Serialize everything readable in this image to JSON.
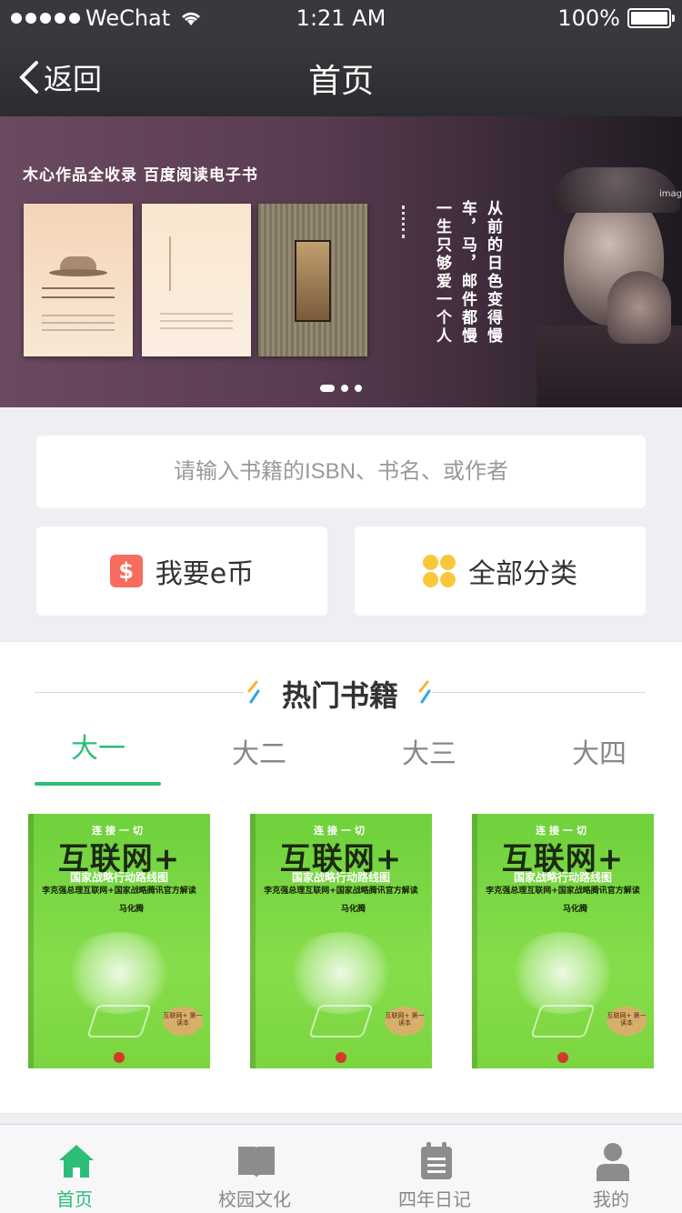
{
  "status_bar": {
    "carrier": "WeChat",
    "time": "1:21 AM",
    "battery": "100%"
  },
  "nav": {
    "back_label": "返回",
    "title": "首页"
  },
  "banner": {
    "headline": "木心作品全收录  百度阅读电子书",
    "poem_columns": [
      "从前的日色变得慢",
      "车，马，邮件都慢",
      "一生只够爱一个人"
    ],
    "side_text": "imag",
    "active_page": 1,
    "page_count": 3
  },
  "search": {
    "placeholder": "请输入书籍的ISBN、书名、或作者"
  },
  "quick_actions": {
    "ecoin_label": "我要e币",
    "ecoin_glyph": "$",
    "categories_label": "全部分类"
  },
  "hot_books": {
    "title": "热门书籍",
    "tabs": [
      "大一",
      "大二",
      "大三",
      "大四"
    ],
    "active_tab": 0,
    "books": [
      {
        "top": "连接一切",
        "title": "互联网+",
        "subtitle": "国家战略行动路线图",
        "tagline": "李克强总理互联网+国家战略腾讯官方解读",
        "author": "马化腾",
        "seal": "互联网+ 第一读本"
      },
      {
        "top": "连接一切",
        "title": "互联网+",
        "subtitle": "国家战略行动路线图",
        "tagline": "李克强总理互联网+国家战略腾讯官方解读",
        "author": "马化腾",
        "seal": "互联网+ 第一读本"
      },
      {
        "top": "连接一切",
        "title": "互联网+",
        "subtitle": "国家战略行动路线图",
        "tagline": "李克强总理互联网+国家战略腾讯官方解读",
        "author": "马化腾",
        "seal": "互联网+ 第一读本"
      }
    ]
  },
  "tab_bar": {
    "items": [
      {
        "label": "首页",
        "icon": "home-icon"
      },
      {
        "label": "校园文化",
        "icon": "book-icon"
      },
      {
        "label": "四年日记",
        "icon": "calendar-icon"
      },
      {
        "label": "我的",
        "icon": "user-icon"
      }
    ],
    "active": 0
  },
  "colors": {
    "accent": "#2dbd78",
    "ecoin": "#f76c5e",
    "categories": "#fbc73a",
    "navbar": "#39393d"
  }
}
